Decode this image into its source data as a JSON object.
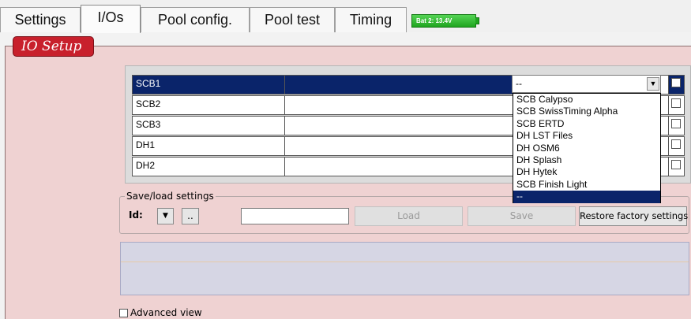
{
  "tabs": [
    {
      "label": "Settings"
    },
    {
      "label": "I/Os"
    },
    {
      "label": "Pool config."
    },
    {
      "label": "Pool test"
    },
    {
      "label": "Timing"
    }
  ],
  "battery": {
    "label": "Bat 2: 13.4V"
  },
  "section": {
    "title": "IO Setup"
  },
  "io_rows": [
    {
      "name": "SCB1",
      "value": "",
      "selected": true
    },
    {
      "name": "SCB2",
      "value": ""
    },
    {
      "name": "SCB3",
      "value": ""
    },
    {
      "name": "DH1",
      "value": ""
    },
    {
      "name": "DH2",
      "value": ""
    }
  ],
  "combo": {
    "selected": "--"
  },
  "dropdown_options": [
    "SCB Calypso",
    "SCB SwissTiming Alpha",
    "SCB ERTD",
    "DH LST Files",
    "DH OSM6",
    "DH Splash",
    "DH Hytek",
    "SCB Finish Light",
    "--"
  ],
  "save_load": {
    "legend": "Save/load settings",
    "id_label": "Id:",
    "browse_label": "..",
    "load_label": "Load",
    "save_label": "Save",
    "restore_label": "Restore factory settings",
    "input_value": ""
  },
  "advanced": {
    "label": "Advanced view"
  },
  "colors": {
    "panel_bg": "#efd2d2",
    "title_bg": "#c8202c",
    "selection": "#0a246a",
    "battery": "#2db52d"
  }
}
